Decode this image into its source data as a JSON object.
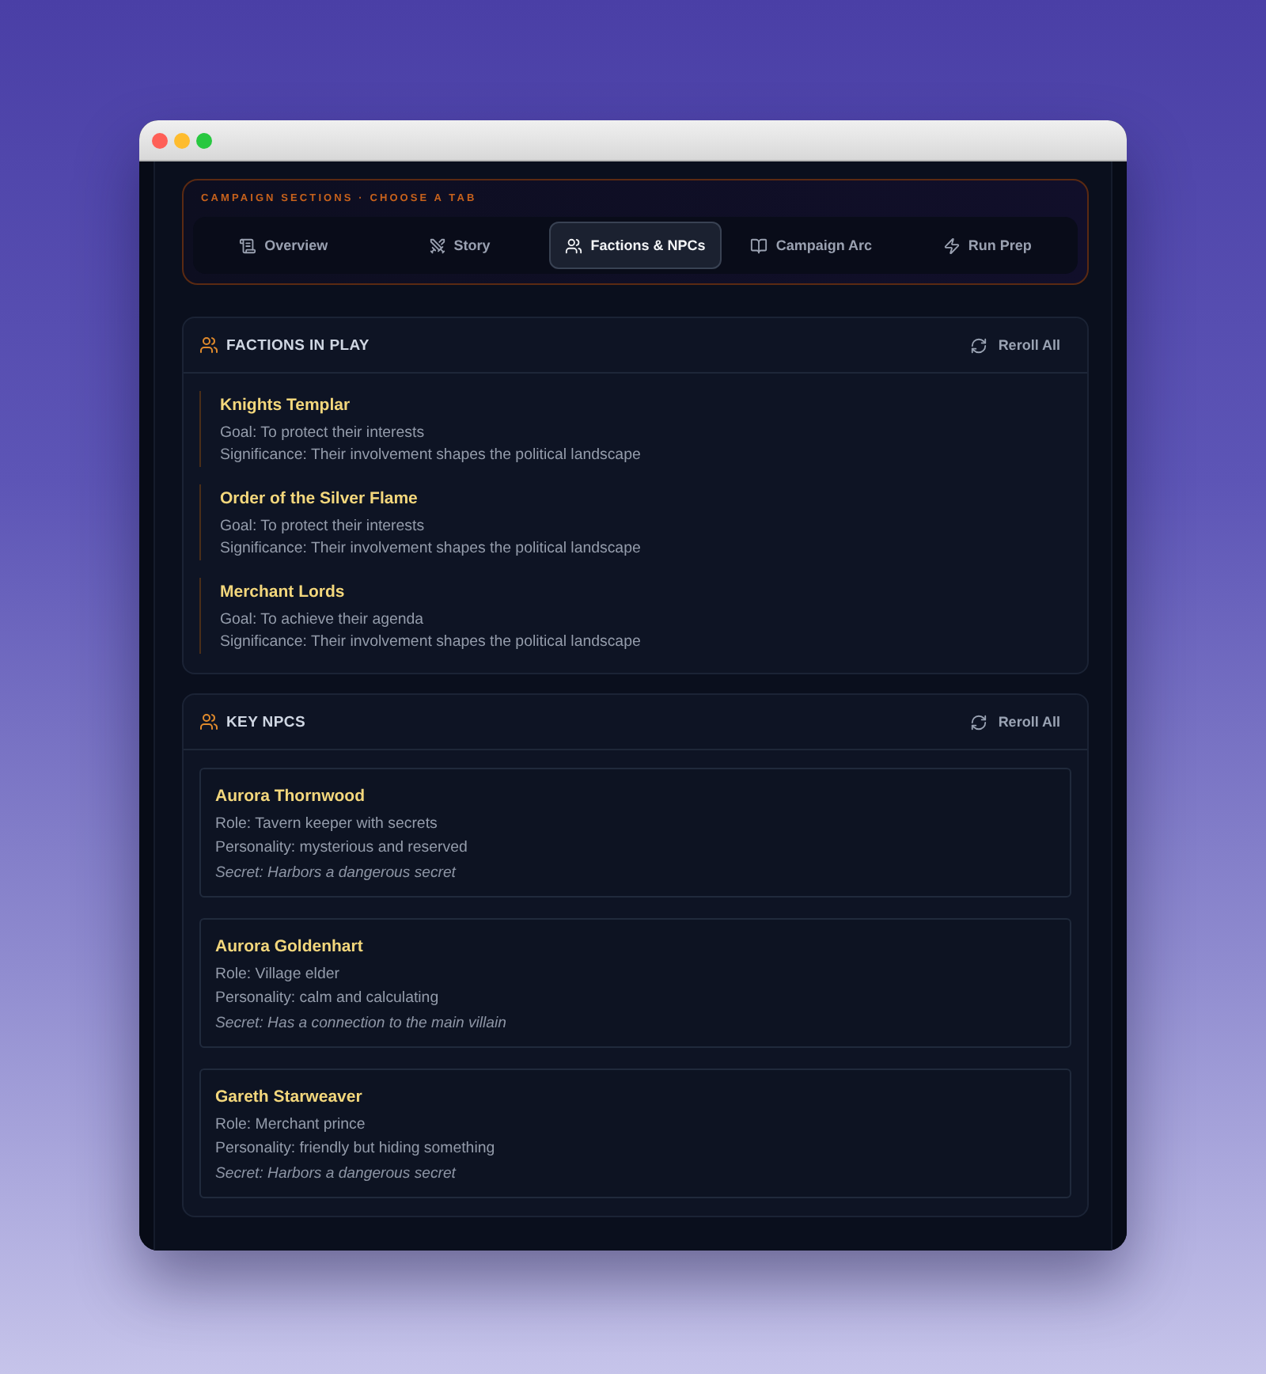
{
  "nav": {
    "label": "CAMPAIGN SECTIONS · CHOOSE A TAB",
    "tabs": [
      {
        "label": "Overview",
        "selected": false
      },
      {
        "label": "Story",
        "selected": false
      },
      {
        "label": "Factions & NPCs",
        "selected": true
      },
      {
        "label": "Campaign Arc",
        "selected": false
      },
      {
        "label": "Run Prep",
        "selected": false
      }
    ]
  },
  "factions": {
    "title": "FACTIONS IN PLAY",
    "action": "Reroll All",
    "items": [
      {
        "name": "Knights Templar",
        "goal": "Goal: To protect their interests",
        "significance": "Significance: Their involvement shapes the political landscape"
      },
      {
        "name": "Order of the Silver Flame",
        "goal": "Goal: To protect their interests",
        "significance": "Significance: Their involvement shapes the political landscape"
      },
      {
        "name": "Merchant Lords",
        "goal": "Goal: To achieve their agenda",
        "significance": "Significance: Their involvement shapes the political landscape"
      }
    ]
  },
  "npcs": {
    "title": "KEY NPCS",
    "action": "Reroll All",
    "items": [
      {
        "name": "Aurora Thornwood",
        "role": "Role: Tavern keeper with secrets",
        "personality": "Personality: mysterious and reserved",
        "secret": "Secret: Harbors a dangerous secret"
      },
      {
        "name": "Aurora Goldenhart",
        "role": "Role: Village elder",
        "personality": "Personality: calm and calculating",
        "secret": "Secret: Has a connection to the main villain"
      },
      {
        "name": "Gareth Starweaver",
        "role": "Role: Merchant prince",
        "personality": "Personality: friendly but hiding something",
        "secret": "Secret: Harbors a dangerous secret"
      }
    ]
  }
}
